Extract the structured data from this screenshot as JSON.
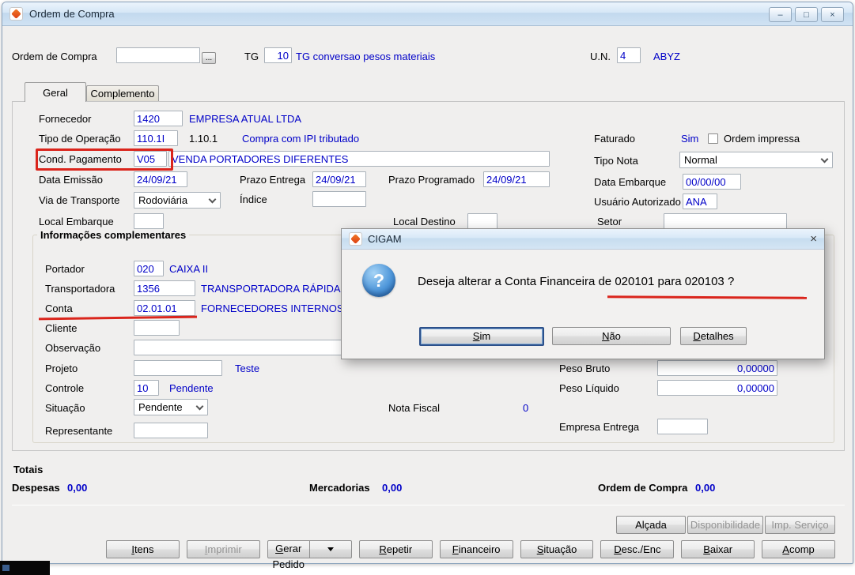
{
  "colors": {
    "link_blue": "#0000c8",
    "annotation_red": "#da251c"
  },
  "icons": {
    "minimize": "–",
    "restore": "□",
    "close": "×",
    "browse": "...",
    "question": "?"
  },
  "window": {
    "title": "Ordem de Compra"
  },
  "header": {
    "ordem": {
      "label": "Ordem de Compra",
      "value": ""
    },
    "tg": {
      "label": "TG",
      "value": "10",
      "desc": "TG conversao pesos materiais"
    },
    "un": {
      "label": "U.N.",
      "value": "4",
      "desc": "ABYZ"
    }
  },
  "tabs": [
    {
      "label": "Geral"
    },
    {
      "label": "Complemento"
    }
  ],
  "geral": {
    "fornecedor": {
      "label": "Fornecedor",
      "value": "1420",
      "desc": "EMPRESA ATUAL LTDA"
    },
    "tipo_operacao": {
      "label": "Tipo de Operação",
      "value": "110.1I",
      "code": "1.10.1",
      "desc": "Compra com IPI tributado"
    },
    "faturado": {
      "label": "Faturado",
      "value": "Sim"
    },
    "ordem_impressa": {
      "label": "Ordem impressa",
      "checked": false
    },
    "cond_pagamento": {
      "label": "Cond. Pagamento",
      "value": "V05",
      "desc": "VENDA PORTADORES DIFERENTES"
    },
    "tipo_nota": {
      "label": "Tipo Nota",
      "value": "Normal"
    },
    "data_emissao": {
      "label": "Data Emissão",
      "value": "24/09/21"
    },
    "prazo_entrega": {
      "label": "Prazo Entrega",
      "value": "24/09/21"
    },
    "prazo_programado": {
      "label": "Prazo Programado",
      "value": "24/09/21"
    },
    "data_embarque": {
      "label": "Data Embarque",
      "value": "00/00/00"
    },
    "via_transporte": {
      "label": "Via de Transporte",
      "value": "Rodoviária"
    },
    "indice": {
      "label": "Índice",
      "value": ""
    },
    "usuario_autorizado": {
      "label": "Usuário Autorizado",
      "value": "ANA"
    },
    "local_embarque": {
      "label": "Local Embarque",
      "value": ""
    },
    "local_destino": {
      "label": "Local Destino",
      "value": ""
    },
    "setor": {
      "label": "Setor",
      "value": ""
    }
  },
  "info": {
    "title": "Informações complementares",
    "portador": {
      "label": "Portador",
      "value": "020",
      "desc": "CAIXA II"
    },
    "transportadora": {
      "label": "Transportadora",
      "value": "1356",
      "desc": "TRANSPORTADORA RÁPIDA"
    },
    "conta": {
      "label": "Conta",
      "value": "02.01.01",
      "desc": "FORNECEDORES INTERNOS"
    },
    "cliente": {
      "label": "Cliente",
      "value": ""
    },
    "observacao": {
      "label": "Observação",
      "value": ""
    },
    "projeto": {
      "label": "Projeto",
      "value": "",
      "desc": "Teste"
    },
    "controle": {
      "label": "Controle",
      "value": "10",
      "desc": "Pendente"
    },
    "situacao": {
      "label": "Situação",
      "value": "Pendente"
    },
    "nota_fiscal": {
      "label": "Nota Fiscal",
      "value": "0"
    },
    "representante": {
      "label": "Representante",
      "value": ""
    },
    "peso_bruto": {
      "label": "Peso Bruto",
      "value": "0,00000"
    },
    "peso_liquido": {
      "label": "Peso Líquido",
      "value": "0,00000"
    },
    "empresa_entrega": {
      "label": "Empresa Entrega",
      "value": ""
    }
  },
  "totais": {
    "title": "Totais",
    "despesas": {
      "label": "Despesas",
      "value": "0,00"
    },
    "mercadorias": {
      "label": "Mercadorias",
      "value": "0,00"
    },
    "ordem": {
      "label": "Ordem de Compra",
      "value": "0,00"
    }
  },
  "actions": {
    "top": [
      {
        "label": "Alçada",
        "disabled": false
      },
      {
        "label": "Disponibilidade",
        "disabled": true
      },
      {
        "label": "Imp. Serviço",
        "disabled": true
      }
    ],
    "bottom": [
      {
        "label": "Itens",
        "disabled": false
      },
      {
        "label": "Imprimir",
        "disabled": true
      },
      {
        "label": "Gerar Pedido",
        "disabled": false
      },
      {
        "label": "Repetir",
        "disabled": false
      },
      {
        "label": "Financeiro",
        "disabled": false
      },
      {
        "label": "Situação",
        "disabled": false
      },
      {
        "label": "Desc./Enc",
        "disabled": false
      },
      {
        "label": "Baixar",
        "disabled": false
      },
      {
        "label": "Acomp",
        "disabled": false
      }
    ]
  },
  "dialog": {
    "title": "CIGAM",
    "message_prefix": "Deseja alterar a Conta Financeira de ",
    "message_highlight": "020101 para 020103",
    "message_suffix": " ?",
    "buttons": [
      {
        "label": "Sim",
        "default": true
      },
      {
        "label": "Não",
        "default": false
      },
      {
        "label": "Detalhes",
        "default": false
      }
    ]
  }
}
